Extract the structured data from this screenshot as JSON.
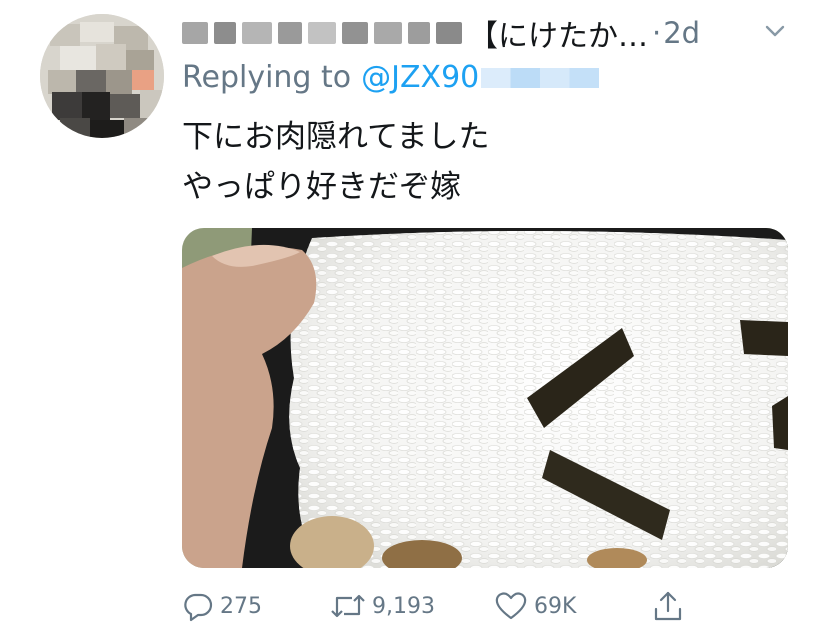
{
  "tweet": {
    "display_name": "【にけたか…",
    "separator": "·",
    "time": "2d",
    "reply_prefix": "Replying to",
    "reply_handle": "@JZX90",
    "text_line1": "下にお肉隠れてました",
    "text_line2": "やっぱり好きだぞ嫁",
    "photo_icon": "bento-rice-photo",
    "menu_icon": "chevron-down-icon"
  },
  "actions": {
    "reply": {
      "icon": "reply-icon",
      "count": "275"
    },
    "retweet": {
      "icon": "retweet-icon",
      "count": "9,193"
    },
    "like": {
      "icon": "heart-icon",
      "count": "69K"
    },
    "share": {
      "icon": "share-icon"
    }
  },
  "colors": {
    "text": "#14171a",
    "secondary": "#657786",
    "accent": "#1da1f2"
  }
}
